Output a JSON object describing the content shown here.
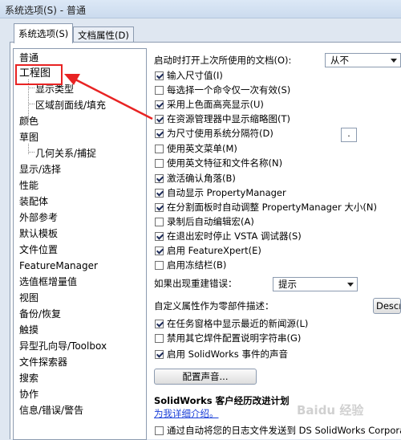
{
  "window": {
    "title": "系统选项(S) - 普通"
  },
  "tabs": [
    {
      "label": "系统选项(S)",
      "active": true
    },
    {
      "label": "文档属性(D)",
      "active": false
    }
  ],
  "tree": {
    "items": [
      "普通",
      "工程图",
      "显示类型",
      "区域剖面线/填充",
      "颜色",
      "草图",
      "几何关系/捕捉",
      "显示/选择",
      "性能",
      "装配体",
      "外部参考",
      "默认模板",
      "文件位置",
      "FeatureManager",
      "选值框增量值",
      "视图",
      "备份/恢复",
      "触摸",
      "异型孔向导/Toolbox",
      "文件探索器",
      "搜索",
      "协作",
      "信息/错误/警告"
    ]
  },
  "options": {
    "startup_label": "启动时打开上次所使用的文档(O):",
    "startup_value": "从不",
    "checks": [
      {
        "label": "输入尺寸值(I)",
        "checked": true
      },
      {
        "label": "每选择一个命令仅一次有效(S)",
        "checked": false
      },
      {
        "label": "采用上色面高亮显示(U)",
        "checked": true
      },
      {
        "label": "在资源管理器中显示缩略图(T)",
        "checked": true
      },
      {
        "label": "为尺寸使用系统分隔符(D)",
        "checked": true
      },
      {
        "label": "使用英文菜单(M)",
        "checked": false
      },
      {
        "label": "使用英文特征和文件名称(N)",
        "checked": false
      },
      {
        "label": "激活确认角落(B)",
        "checked": true
      },
      {
        "label": "自动显示 PropertyManager",
        "checked": true
      },
      {
        "label": "在分割面板时自动调整 PropertyManager 大小(N)",
        "checked": true
      },
      {
        "label": "录制后自动编辑宏(A)",
        "checked": false
      },
      {
        "label": "在退出宏时停止 VSTA 调试器(S)",
        "checked": true
      },
      {
        "label": "启用 FeatureXpert(E)",
        "checked": true
      },
      {
        "label": "启用冻结栏(B)",
        "checked": false
      }
    ],
    "separator_value": ".",
    "rebuild_label": "如果出现重建错误：",
    "rebuild_value": "提示",
    "custom_prop_label": "自定义属性作为零部件描述：",
    "custom_prop_value": "Descri",
    "checks2": [
      {
        "label": "在任务窗格中显示最近的新闻源(L)",
        "checked": true
      },
      {
        "label": "禁用其它焊件配置说明字符串(G)",
        "checked": false
      },
      {
        "label": "启用 SolidWorks 事件的声音",
        "checked": true
      }
    ],
    "sound_button": "配置声音...",
    "program_title": "SolidWorks 客户经历改进计划",
    "program_link": "为我详细介绍。",
    "last_check": {
      "label": "通过自动将您的日志文件发送到 DS SolidWorks Corporat",
      "checked": false
    }
  },
  "watermark": "Baidu 经验"
}
